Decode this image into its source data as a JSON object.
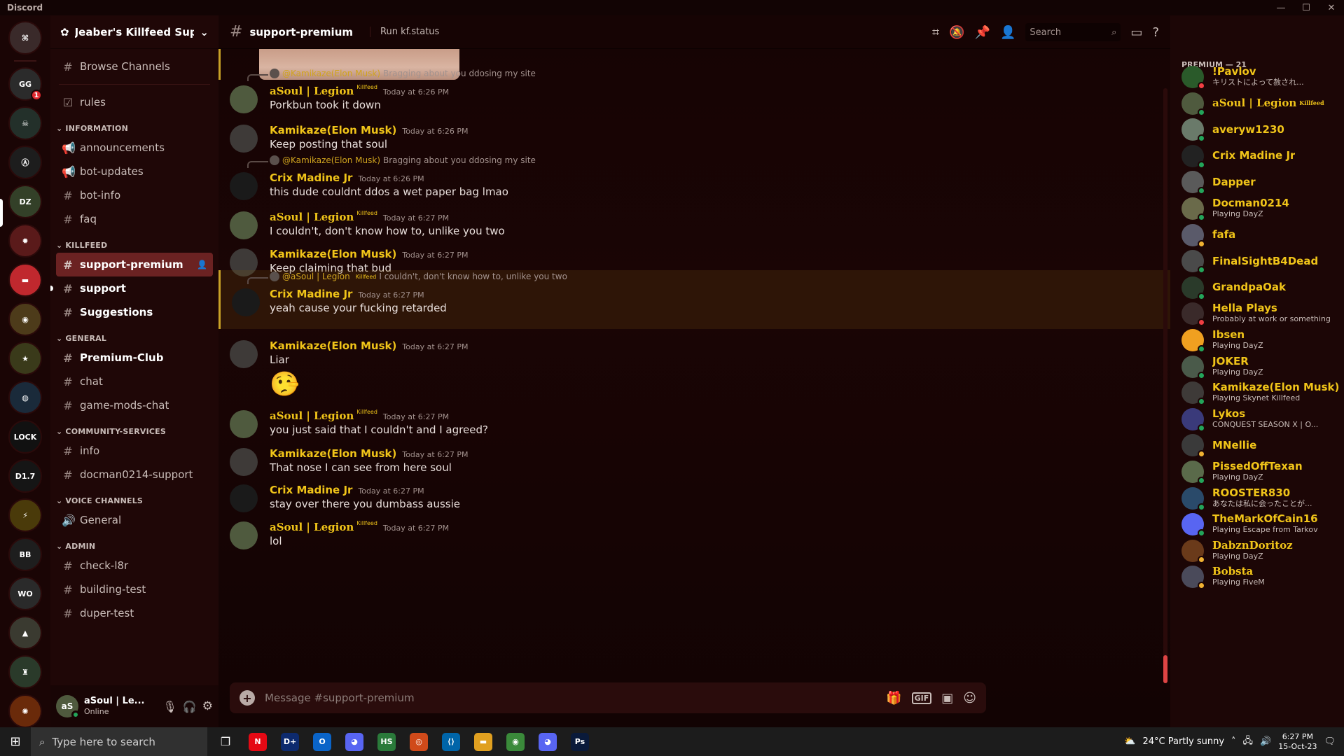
{
  "window": {
    "title": "Discord",
    "controls": [
      "—",
      "☐",
      "✕"
    ]
  },
  "servers": {
    "items": [
      {
        "label": "⌘",
        "bg": "#3a2a2a"
      },
      {
        "label": "GG",
        "bg": "#2b2b2b",
        "badge": "1"
      },
      {
        "label": "☠",
        "bg": "#23302a"
      },
      {
        "label": "Ⓐ",
        "bg": "#1d1d1d"
      },
      {
        "label": "DZ",
        "bg": "#334028"
      },
      {
        "label": "✹",
        "bg": "#5a1a1a"
      },
      {
        "label": "▬",
        "bg": "#c0282e"
      },
      {
        "label": "◉",
        "bg": "#4d3b1a"
      },
      {
        "label": "★",
        "bg": "#3a3a1a"
      },
      {
        "label": "◍",
        "bg": "#1a2a3a"
      },
      {
        "label": "LOCK",
        "bg": "#111"
      },
      {
        "label": "D1.7",
        "bg": "#151515"
      },
      {
        "label": "⚡",
        "bg": "#4a3a0a"
      },
      {
        "label": "BB",
        "bg": "#1e1e1e"
      },
      {
        "label": "WO",
        "bg": "#2a2a2a"
      },
      {
        "label": "▲",
        "bg": "#3a3a30"
      },
      {
        "label": "♜",
        "bg": "#2a3a2a"
      },
      {
        "label": "✺",
        "bg": "#6a2a0a"
      }
    ]
  },
  "sidebar": {
    "server_name": "Jeaber's Killfeed Sup...",
    "browse": "Browse Channels",
    "rules": "rules",
    "categories": [
      {
        "name": "INFORMATION",
        "channels": [
          {
            "icon": "📢",
            "name": "announcements"
          },
          {
            "icon": "📢",
            "name": "bot-updates"
          },
          {
            "icon": "#",
            "name": "bot-info"
          },
          {
            "icon": "#",
            "name": "faq"
          }
        ]
      },
      {
        "name": "KILLFEED",
        "channels": [
          {
            "icon": "#",
            "name": "support-premium"
          },
          {
            "icon": "#",
            "name": "support"
          },
          {
            "icon": "#",
            "name": "Suggestions"
          }
        ]
      },
      {
        "name": "GENERAL",
        "channels": [
          {
            "icon": "#",
            "name": "Premium-Club"
          },
          {
            "icon": "#",
            "name": "chat"
          },
          {
            "icon": "#",
            "name": "game-mods-chat"
          }
        ]
      },
      {
        "name": "COMMUNITY-SERVICES",
        "channels": [
          {
            "icon": "#",
            "name": "info"
          },
          {
            "icon": "#",
            "name": "docman0214-support"
          }
        ]
      },
      {
        "name": "VOICE CHANNELS",
        "channels": [
          {
            "icon": "🔊",
            "name": "General"
          }
        ]
      },
      {
        "name": "ADMIN",
        "channels": [
          {
            "icon": "#",
            "name": "check-l8r"
          },
          {
            "icon": "#",
            "name": "building-test"
          },
          {
            "icon": "#",
            "name": "duper-test"
          }
        ]
      }
    ],
    "user": {
      "name": "aSoul | Le...",
      "status": "Online"
    }
  },
  "header": {
    "channel": "support-premium",
    "topic": "Run kf.status",
    "search_placeholder": "Search"
  },
  "messages": [
    {
      "reply_to": "@Kamikaze(Elon Musk)",
      "reply_text": "Bragging about you ddosing my site",
      "author": "aSoul | Legion",
      "tag": "Killfeed",
      "time": "Today at 6:26 PM",
      "text": "Porkbun took it down"
    },
    {
      "author": "Kamikaze(Elon Musk)",
      "time": "Today at 6:26 PM",
      "text": "Keep posting that soul"
    },
    {
      "reply_to": "@Kamikaze(Elon Musk)",
      "reply_text": "Bragging about you ddosing my site",
      "author": "Crix Madine Jr",
      "time": "Today at 6:26 PM",
      "text": "this dude couldnt ddos a wet paper bag lmao"
    },
    {
      "author": "aSoul | Legion",
      "tag": "Killfeed",
      "time": "Today at 6:27 PM",
      "text": "I couldn't, don't know how to, unlike you two"
    },
    {
      "author": "Kamikaze(Elon Musk)",
      "time": "Today at 6:27 PM",
      "text": "Keep claiming that bud"
    },
    {
      "reply_to": "@aSoul | Legion",
      "reply_tag": "Killfeed",
      "reply_text": "I couldn't, don't know how to, unlike you two",
      "author": "Crix Madine Jr",
      "time": "Today at 6:27 PM",
      "text": "yeah cause your fucking retarded"
    },
    {
      "author": "Kamikaze(Elon Musk)",
      "time": "Today at 6:27 PM",
      "text": "Liar",
      "emoji": "🤥"
    },
    {
      "author": "aSoul | Legion",
      "tag": "Killfeed",
      "time": "Today at 6:27 PM",
      "text": "you just said that I couldn't and I agreed?"
    },
    {
      "author": "Kamikaze(Elon Musk)",
      "time": "Today at 6:27 PM",
      "text": "That nose I can see from here soul"
    },
    {
      "author": "Crix Madine Jr",
      "time": "Today at 6:27 PM",
      "text": "stay over there you dumbass aussie"
    },
    {
      "author": "aSoul | Legion",
      "tag": "Killfeed",
      "time": "Today at 6:27 PM",
      "text": "lol"
    }
  ],
  "composer": {
    "placeholder": "Message #support-premium",
    "gif": "GIF"
  },
  "members": {
    "header": "PREMIUM — 21",
    "list": [
      {
        "name": "!Pavlov",
        "status": "キリストによって赦され...",
        "dot": "#f23f43"
      },
      {
        "name": "aSoul | Legion",
        "tag": "Killfeed",
        "status": "",
        "dot": "#23a55a"
      },
      {
        "name": "averyw1230",
        "status": "",
        "dot": "#23a55a"
      },
      {
        "name": "Crix Madine Jr",
        "status": "",
        "dot": "#23a55a"
      },
      {
        "name": "Dapper",
        "status": "",
        "dot": "#23a55a"
      },
      {
        "name": "Docman0214",
        "status": "Playing DayZ",
        "dot": "#23a55a"
      },
      {
        "name": "fafa",
        "status": "",
        "dot": "#f0b232"
      },
      {
        "name": "FinalSightB4Dead",
        "status": "",
        "dot": "#23a55a"
      },
      {
        "name": "GrandpaOak",
        "status": "",
        "dot": "#23a55a"
      },
      {
        "name": "Hella Plays",
        "status": "Probably at work or something!",
        "dot": "#f23f43"
      },
      {
        "name": "Ibsen",
        "status": "Playing DayZ",
        "dot": "#23a55a"
      },
      {
        "name": "JOKER",
        "status": "Playing DayZ",
        "dot": "#23a55a"
      },
      {
        "name": "Kamikaze(Elon Musk)",
        "status": "Playing Skynet Killfeed",
        "dot": "#23a55a"
      },
      {
        "name": "Lykos",
        "status": "CONQUEST SEASON X | O...",
        "dot": "#23a55a"
      },
      {
        "name": "MNellie",
        "status": "",
        "dot": "#f0b232"
      },
      {
        "name": "PissedOffTexan",
        "status": "Playing DayZ",
        "dot": "#23a55a"
      },
      {
        "name": "ROOSTER830",
        "status": "あなたは私に会ったことが...",
        "dot": "#23a55a"
      },
      {
        "name": "TheMarkOfCain16",
        "status": "Playing Escape from Tarkov",
        "dot": "#23a55a"
      },
      {
        "name": "DabznDoritoz",
        "status": "Playing DayZ",
        "dot": "#f0b232"
      },
      {
        "name": "Bobsta",
        "status": "Playing FiveM",
        "dot": "#f0b232"
      }
    ]
  },
  "taskbar": {
    "search_placeholder": "Type here to search",
    "weather": "24°C  Partly sunny",
    "time": "6:27 PM",
    "date": "15-Oct-23",
    "apps": [
      {
        "label": "N",
        "bg": "#e50914"
      },
      {
        "label": "D+",
        "bg": "#0d2a6e"
      },
      {
        "label": "O",
        "bg": "#0a64c8"
      },
      {
        "label": "◕",
        "bg": "#5865f2"
      },
      {
        "label": "HS",
        "bg": "#2a7a3a"
      },
      {
        "label": "◎",
        "bg": "#d04a1a"
      },
      {
        "label": "⟨⟩",
        "bg": "#0065a9"
      },
      {
        "label": "▬",
        "bg": "#e0a020"
      },
      {
        "label": "◉",
        "bg": "#3a8a3a"
      },
      {
        "label": "◕",
        "bg": "#5865f2"
      },
      {
        "label": "Ps",
        "bg": "#0a1a3a"
      }
    ]
  }
}
